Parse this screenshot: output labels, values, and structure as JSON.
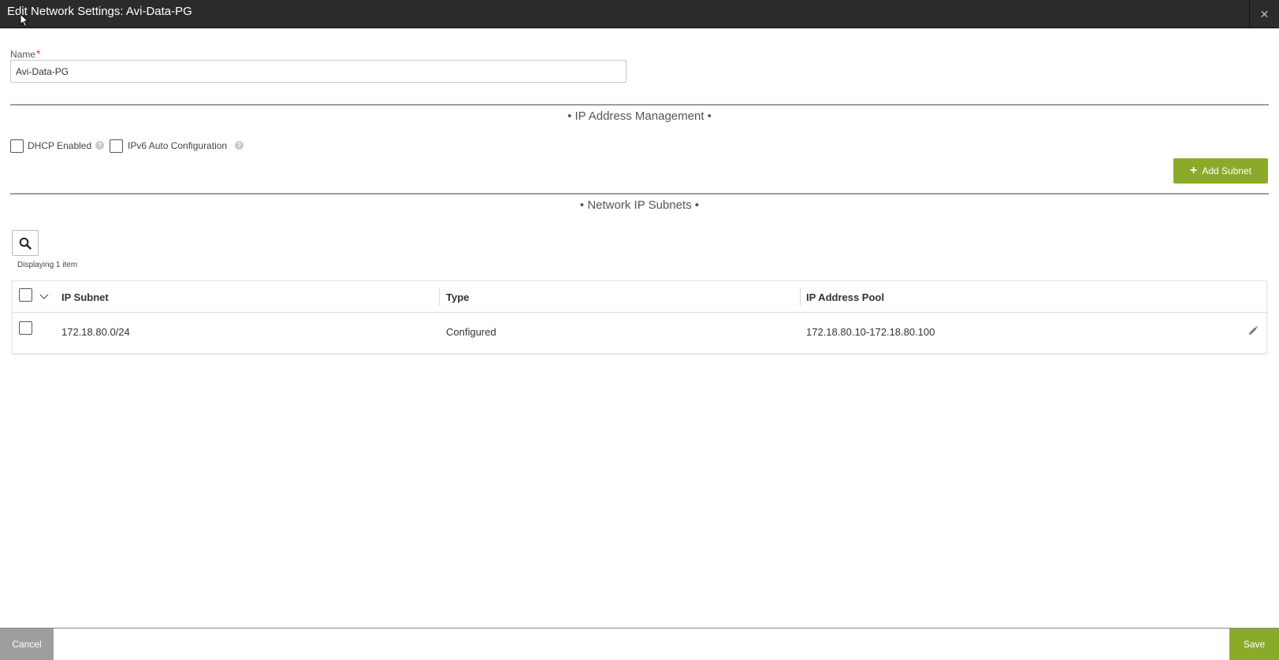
{
  "window": {
    "title": "Edit Network Settings: Avi-Data-PG",
    "close_icon": "close-icon"
  },
  "form": {
    "name_label": "Name",
    "required_marker": "*",
    "name_value": "Avi-Data-PG"
  },
  "ipam": {
    "section_title": "• IP Address Management •",
    "dhcp_label": "DHCP Enabled",
    "dhcp_checked": false,
    "ipv6_label": "IPv6 Auto Configuration",
    "ipv6_checked": false,
    "help_icon": "help-icon",
    "add_subnet_label": "Add Subnet"
  },
  "subnets": {
    "section_title": "• Network IP Subnets •",
    "display_count": "Displaying 1 item",
    "columns": [
      "IP Subnet",
      "Type",
      "IP Address Pool"
    ],
    "rows": [
      {
        "subnet": "172.18.80.0/24",
        "type": "Configured",
        "pool": "172.18.80.10-172.18.80.100"
      }
    ]
  },
  "footer": {
    "cancel_label": "Cancel",
    "save_label": "Save"
  },
  "colors": {
    "accent_green": "#8aab2a",
    "titlebar_bg": "#2b2b2b",
    "cancel_gray": "#9e9e9e"
  }
}
